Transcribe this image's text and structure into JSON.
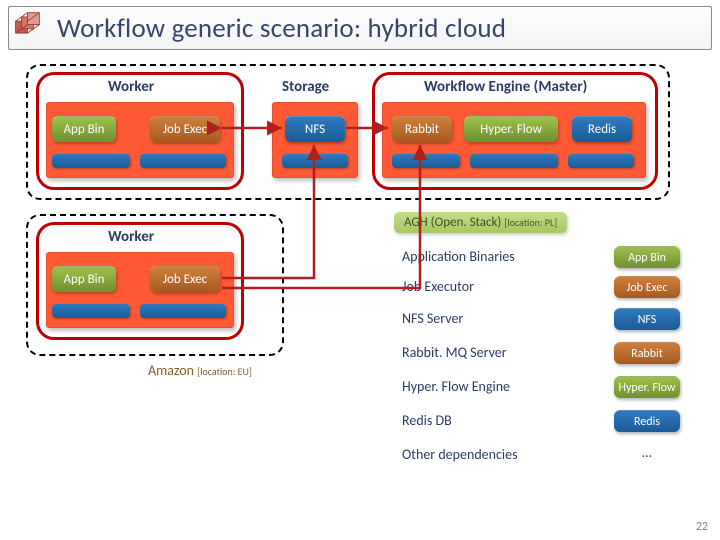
{
  "title": "Workflow generic scenario: hybrid cloud",
  "headers": {
    "worker": "Worker",
    "storage": "Storage",
    "engine": "Workflow Engine (Master)"
  },
  "components": {
    "app_bin": "App Bin",
    "job_exec": "Job Exec",
    "nfs": "NFS",
    "rabbit": "Rabbit",
    "hyperflow": "Hyper. Flow",
    "redis": "Redis"
  },
  "cloud": {
    "agh": "AGH (Open. Stack)",
    "agh_loc": "[location: PL]",
    "amazon": "Amazon",
    "amazon_loc": "[location: EU]"
  },
  "legend": [
    {
      "key": "Application Binaries",
      "comp": "App Bin",
      "cls": "green"
    },
    {
      "key": "Job Executor",
      "comp": "Job Exec",
      "cls": "orange"
    },
    {
      "key": "NFS Server",
      "comp": "NFS",
      "cls": "blue"
    },
    {
      "key": "Rabbit. MQ Server",
      "comp": "Rabbit",
      "cls": "orange"
    },
    {
      "key": "Hyper. Flow Engine",
      "comp": "Hyper. Flow",
      "cls": "green"
    },
    {
      "key": "Redis DB",
      "comp": "Redis",
      "cls": "blue"
    },
    {
      "key": "Other dependencies",
      "comp": "…",
      "cls": "dots"
    }
  ],
  "page": "22"
}
